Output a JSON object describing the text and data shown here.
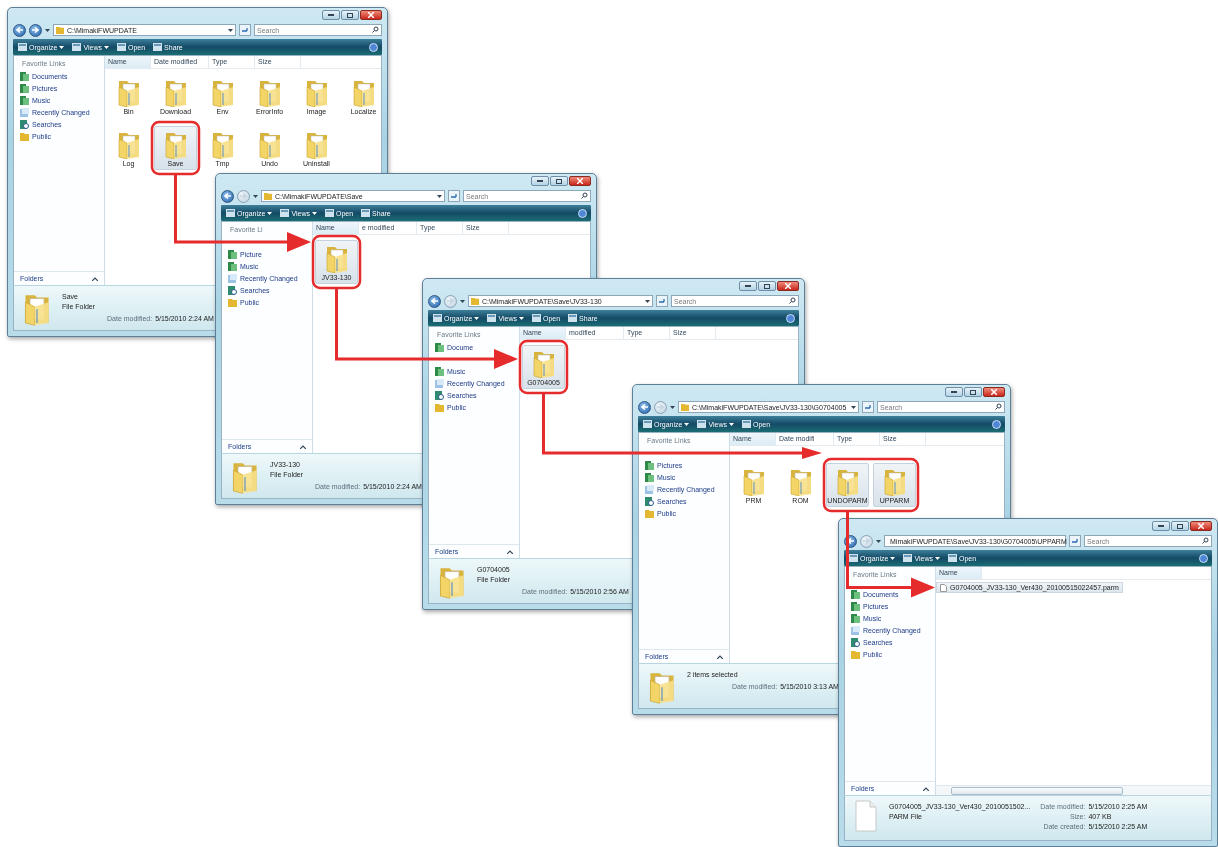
{
  "windows": [
    {
      "address": "C:\\MimakiFWUPDATE",
      "search_placeholder": "Search",
      "toolbar": [
        {
          "label": "Organize",
          "kind": "menu"
        },
        {
          "label": "Views",
          "kind": "menu"
        },
        {
          "label": "Open",
          "kind": "button"
        },
        {
          "label": "Share",
          "kind": "button"
        }
      ],
      "sidebar": {
        "header": "Favorite Links",
        "items": [
          {
            "label": "Documents",
            "kind": "library"
          },
          {
            "label": "Pictures",
            "kind": "library"
          },
          {
            "label": "Music",
            "kind": "library"
          },
          {
            "label": "Recently Changed",
            "kind": "recent"
          },
          {
            "label": "Searches",
            "kind": "search"
          },
          {
            "label": "Public",
            "kind": "folder"
          }
        ],
        "footer": "Folders"
      },
      "columns": [
        "Name",
        "Date modified",
        "Type",
        "Size"
      ],
      "items": [
        {
          "name": "Bin",
          "kind": "folder",
          "selected": false
        },
        {
          "name": "Download",
          "kind": "folder",
          "selected": false
        },
        {
          "name": "Env",
          "kind": "folder",
          "selected": false
        },
        {
          "name": "ErrorInfo",
          "kind": "folder",
          "selected": false
        },
        {
          "name": "Image",
          "kind": "folder",
          "selected": false
        },
        {
          "name": "Localize",
          "kind": "folder",
          "selected": false
        },
        {
          "name": "Log",
          "kind": "folder",
          "selected": false
        },
        {
          "name": "Save",
          "kind": "folder",
          "selected": true
        },
        {
          "name": "Tmp",
          "kind": "folder",
          "selected": false
        },
        {
          "name": "Undo",
          "kind": "folder",
          "selected": false
        },
        {
          "name": "Uninstall",
          "kind": "folder",
          "selected": false
        }
      ],
      "details": {
        "kind": "folder",
        "title": "Save",
        "subtitle": "File Folder",
        "fields": [
          {
            "label": "Date modified:",
            "value": "5/15/2010 2:24 AM"
          }
        ]
      }
    },
    {
      "address": "C:\\MimakiFWUPDATE\\Save",
      "search_placeholder": "Search",
      "toolbar": [
        {
          "label": "Organize",
          "kind": "menu"
        },
        {
          "label": "Views",
          "kind": "menu"
        },
        {
          "label": "Open",
          "kind": "button"
        },
        {
          "label": "Share",
          "kind": "button"
        }
      ],
      "sidebar": {
        "header": "Favorite Li",
        "items": [
          {
            "label": "Picture",
            "kind": "library"
          },
          {
            "label": "Music",
            "kind": "library"
          },
          {
            "label": "Recently Changed",
            "kind": "recent"
          },
          {
            "label": "Searches",
            "kind": "search"
          },
          {
            "label": "Public",
            "kind": "folder"
          }
        ],
        "footer": "Folders"
      },
      "columns": [
        "Name",
        "e modified",
        "Type",
        "Size"
      ],
      "items": [
        {
          "name": "JV33-130",
          "kind": "folder",
          "selected": true
        }
      ],
      "details": {
        "kind": "folder",
        "title": "JV33-130",
        "subtitle": "File Folder",
        "fields": [
          {
            "label": "Date modified:",
            "value": "5/15/2010 2:24 AM"
          }
        ]
      }
    },
    {
      "address": "C:\\MimakiFWUPDATE\\Save\\JV33-130",
      "search_placeholder": "Search",
      "toolbar": [
        {
          "label": "Organize",
          "kind": "menu"
        },
        {
          "label": "Views",
          "kind": "menu"
        },
        {
          "label": "Open",
          "kind": "button"
        },
        {
          "label": "Share",
          "kind": "button"
        }
      ],
      "sidebar": {
        "header": "Favorite Links",
        "items": [
          {
            "label": "Docume",
            "kind": "library"
          },
          {
            "label": "Music",
            "kind": "library"
          },
          {
            "label": "Recently Changed",
            "kind": "recent"
          },
          {
            "label": "Searches",
            "kind": "search"
          },
          {
            "label": "Public",
            "kind": "folder"
          }
        ],
        "footer": "Folders"
      },
      "columns": [
        "Name",
        "modified",
        "Type",
        "Size"
      ],
      "items": [
        {
          "name": "G0704005",
          "kind": "folder",
          "selected": true
        }
      ],
      "details": {
        "kind": "folder",
        "title": "G0704005",
        "subtitle": "File Folder",
        "fields": [
          {
            "label": "Date modified:",
            "value": "5/15/2010 2:56 AM"
          }
        ]
      }
    },
    {
      "address": "C:\\MimakiFWUPDATE\\Save\\JV33-130\\G0704005",
      "search_placeholder": "Search",
      "toolbar": [
        {
          "label": "Organize",
          "kind": "menu"
        },
        {
          "label": "Views",
          "kind": "menu"
        },
        {
          "label": "Open",
          "kind": "button"
        }
      ],
      "sidebar": {
        "header": "Favorite Links",
        "items": [
          {
            "label": "Pictures",
            "kind": "library"
          },
          {
            "label": "Music",
            "kind": "library"
          },
          {
            "label": "Recently Changed",
            "kind": "recent"
          },
          {
            "label": "Searches",
            "kind": "search"
          },
          {
            "label": "Public",
            "kind": "folder"
          }
        ],
        "footer": "Folders"
      },
      "columns": [
        "Name",
        "Date modifi",
        "Type",
        "Size"
      ],
      "items": [
        {
          "name": "PRM",
          "kind": "folder",
          "selected": false
        },
        {
          "name": "ROM",
          "kind": "folder",
          "selected": false
        },
        {
          "name": "UNDOPARM",
          "kind": "folder",
          "selected": true
        },
        {
          "name": "UPPARM",
          "kind": "folder",
          "selected": true
        }
      ],
      "details": {
        "kind": "folder",
        "title": "2 items selected",
        "fields": [
          {
            "label": "Date modified:",
            "value": "5/15/2010 3:13 AM"
          }
        ]
      }
    },
    {
      "address": "MimakiFWUPDATE\\Save\\JV33-130\\G0704005\\UPPARM",
      "search_placeholder": "Search",
      "toolbar": [
        {
          "label": "Organize",
          "kind": "menu"
        },
        {
          "label": "Views",
          "kind": "menu"
        },
        {
          "label": "Open",
          "kind": "button"
        }
      ],
      "sidebar": {
        "header": "Favorite Links",
        "items": [
          {
            "label": "Documents",
            "kind": "library"
          },
          {
            "label": "Pictures",
            "kind": "library"
          },
          {
            "label": "Music",
            "kind": "library"
          },
          {
            "label": "Recently Changed",
            "kind": "recent"
          },
          {
            "label": "Searches",
            "kind": "search"
          },
          {
            "label": "Public",
            "kind": "folder"
          }
        ],
        "footer": "Folders"
      },
      "columns": [
        "Name"
      ],
      "items": [
        {
          "name": "G0704005_JV33-130_Ver430_20100515022457.parm",
          "kind": "file",
          "selected": true
        }
      ],
      "details": {
        "kind": "file",
        "title": "G0704005_JV33-130_Ver430_2010051502...",
        "subtitle": "PARM File",
        "fields": [
          {
            "label": "Date modified:",
            "value": "5/15/2010 2:25 AM"
          },
          {
            "label": "Size:",
            "value": "407 KB"
          },
          {
            "label": "Date created:",
            "value": "5/15/2010 2:25 AM"
          }
        ]
      }
    }
  ]
}
